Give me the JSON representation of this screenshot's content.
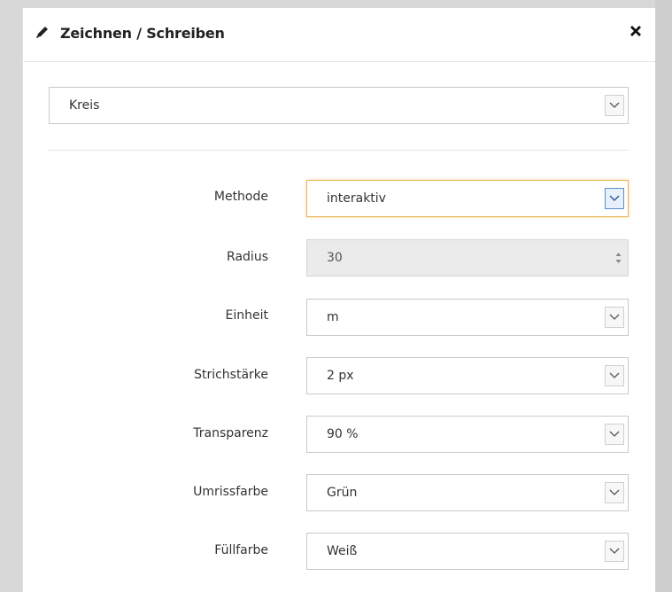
{
  "dialog": {
    "title": "Zeichnen / Schreiben",
    "close_icon": "close-icon",
    "pencil_icon": "pencil-icon"
  },
  "shape": {
    "selected": "Kreis"
  },
  "form": {
    "method": {
      "label": "Methode",
      "value": "interaktiv"
    },
    "radius": {
      "label": "Radius",
      "value": "30"
    },
    "unit": {
      "label": "Einheit",
      "value": "m"
    },
    "stroke": {
      "label": "Strichstärke",
      "value": "2 px"
    },
    "transparency": {
      "label": "Transparenz",
      "value": "90 %"
    },
    "outline_color": {
      "label": "Umrissfarbe",
      "value": "Grün"
    },
    "fill_color": {
      "label": "Füllfarbe",
      "value": "Weiß"
    }
  },
  "colors": {
    "focus_border": "#e8b44c",
    "focus_chevron": "#5a8fc9",
    "disabled_bg": "#ebebeb"
  }
}
